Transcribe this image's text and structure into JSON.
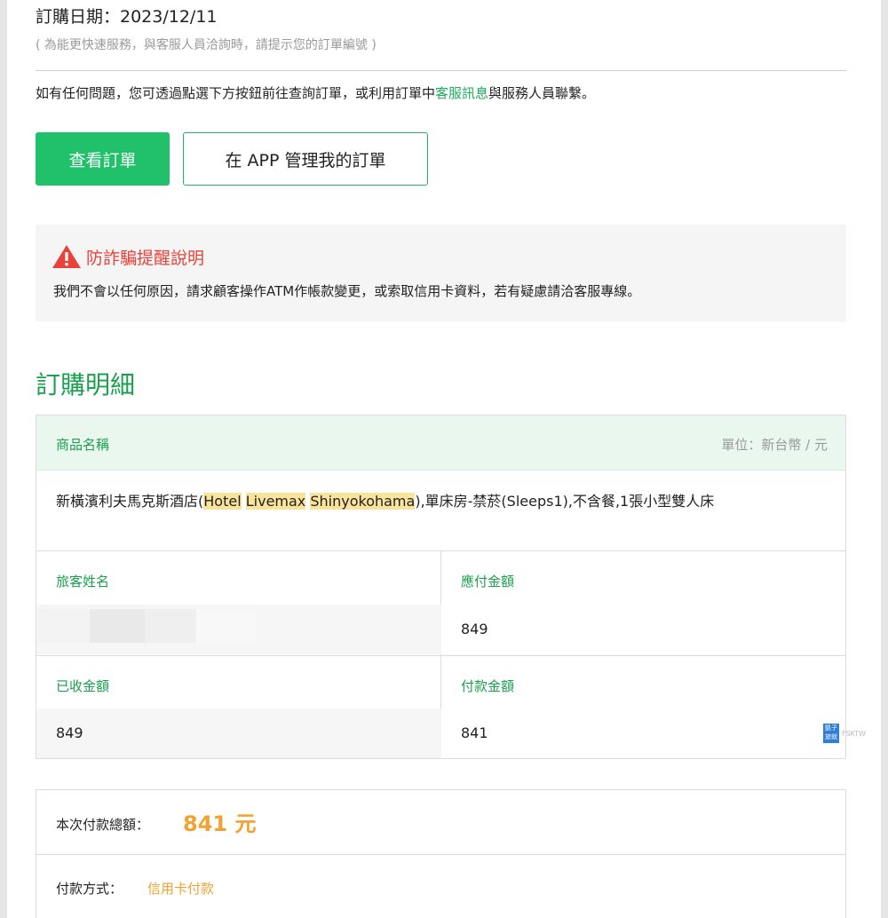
{
  "order": {
    "date_label": "訂購日期：2023/12/11",
    "note": "( 為能更快速服務，與客服人員洽詢時，請提示您的訂單編號 )"
  },
  "info": {
    "text_before": "如有任何問題，您可透過點選下方按鈕前往查詢訂單，或利用訂單中",
    "link_text": "客服訊息",
    "text_after": "與服務人員聯繫。"
  },
  "buttons": {
    "view_order": "查看訂單",
    "manage_in_app": "在 APP 管理我的訂單"
  },
  "alert": {
    "title": "防詐騙提醒說明",
    "body": "我們不會以任何原因，請求顧客操作ATM作帳款變更，或索取信用卡資料，若有疑慮請洽客服專線。"
  },
  "section_title": "訂購明細",
  "detail": {
    "header_name": "商品名稱",
    "header_unit": "單位：新台幣 / 元",
    "product": {
      "part1": "新橫濱利夫馬克斯酒店(",
      "hl1": "Hotel",
      "hl2": "Livemax",
      "hl3": "Shinyokohama",
      "part2": "),單床房-禁菸(Sleeps1),不含餐,1張小型雙人床"
    },
    "guest_label": "旅客姓名",
    "payable_label": "應付金額",
    "payable_value": "849",
    "received_label": "已收金額",
    "received_value": "849",
    "paid_label": "付款金額",
    "paid_value": "841"
  },
  "watermark": {
    "badge": "凱子 旅就",
    "text": "FSKTW"
  },
  "summary": {
    "total_label": "本次付款總額：",
    "total_amount": "841 元",
    "method_label": "付款方式：",
    "method_value": "信用卡付款"
  },
  "colors": {
    "brand_green": "#21c06b",
    "alert_red": "#e8423c",
    "amount_orange": "#f1a232",
    "highlight": "#fae39a"
  }
}
